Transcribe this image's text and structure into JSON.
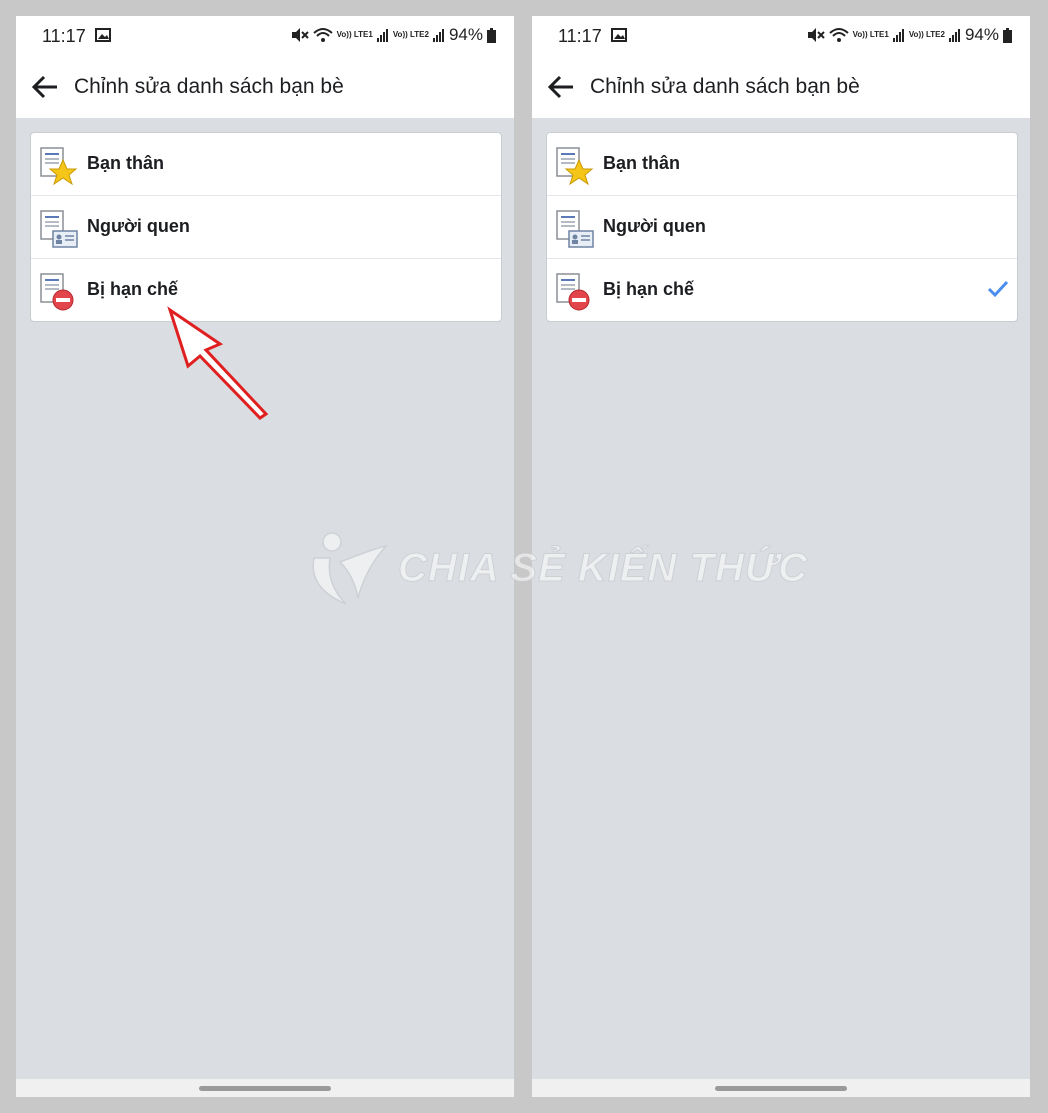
{
  "status_bar": {
    "time": "11:17",
    "net1": "Vo)) LTE1",
    "net2": "Vo)) LTE2",
    "battery": "94%"
  },
  "header": {
    "title": "Chỉnh sửa danh sách bạn bè"
  },
  "friend_lists": [
    {
      "label": "Bạn thân",
      "icon": "close-friends-star-icon"
    },
    {
      "label": "Người quen",
      "icon": "acquaintances-card-icon"
    },
    {
      "label": "Bị hạn chế",
      "icon": "restricted-minus-icon"
    }
  ],
  "selected_index_right": 2,
  "colors": {
    "accent_check": "#4a8ff0",
    "annotation_arrow": "#e02020",
    "restricted_red": "#e2454b",
    "star_yellow": "#f5c518",
    "background": "#dadde1"
  },
  "watermark": "CHIA SẺ KIẾN THỨC"
}
